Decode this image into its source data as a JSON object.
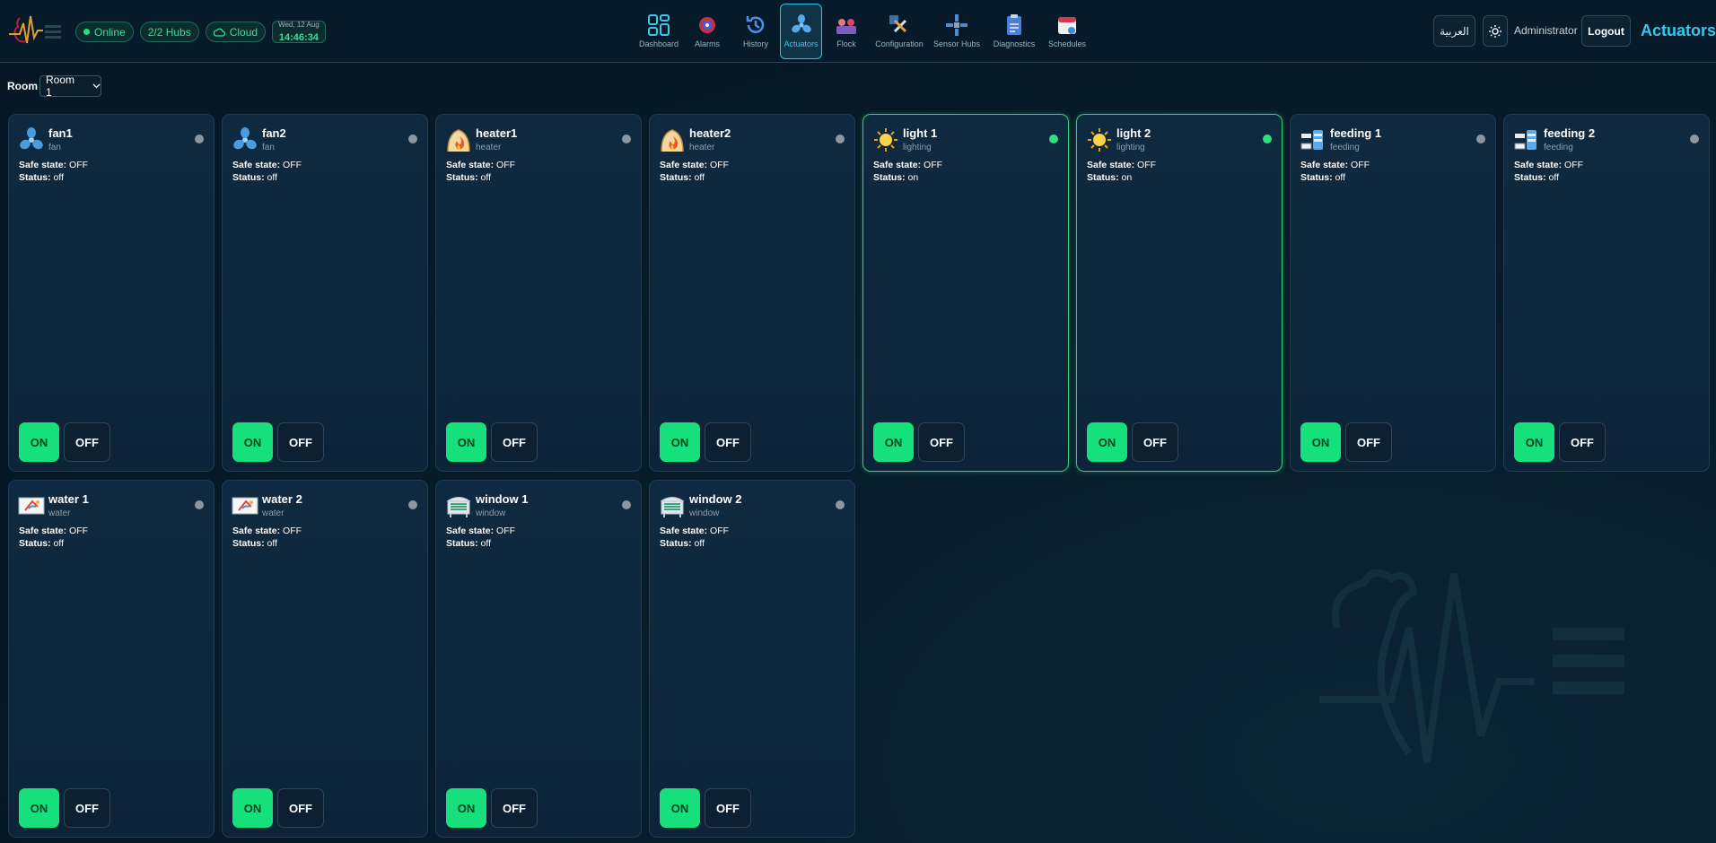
{
  "status": {
    "online_label": "Online",
    "hubs_label": "2/2 Hubs",
    "cloud_label": "Cloud",
    "date": "Wed, 12 Aug",
    "time": "14:46:34"
  },
  "nav": [
    {
      "label": "Dashboard",
      "icon": "dashboard-icon",
      "active": false
    },
    {
      "label": "Alarms",
      "icon": "alarm-icon",
      "active": false
    },
    {
      "label": "History",
      "icon": "history-icon",
      "active": false
    },
    {
      "label": "Actuators",
      "icon": "fan-icon",
      "active": true
    },
    {
      "label": "Flock",
      "icon": "flock-icon",
      "active": false
    },
    {
      "label": "Configuration",
      "icon": "tools-icon",
      "active": false
    },
    {
      "label": "Sensor Hubs",
      "icon": "satellite-icon",
      "active": false
    },
    {
      "label": "Diagnostics",
      "icon": "clipboard-icon",
      "active": false
    },
    {
      "label": "Schedules",
      "icon": "calendar-icon",
      "active": false
    }
  ],
  "header": {
    "language_button": "العربية",
    "theme_icon": "sun-icon",
    "user": "Administrator",
    "logout": "Logout",
    "page_title": "Actuators"
  },
  "room": {
    "label": "Room",
    "selected": "Room 1"
  },
  "labels": {
    "safe_state": "Safe state:",
    "status": "Status:",
    "on": "ON",
    "off": "OFF"
  },
  "actuators": [
    {
      "name": "fan1",
      "type": "fan",
      "safe_state": "OFF",
      "status": "off",
      "icon": "fan-icon"
    },
    {
      "name": "fan2",
      "type": "fan",
      "safe_state": "OFF",
      "status": "off",
      "icon": "fan-icon"
    },
    {
      "name": "heater1",
      "type": "heater",
      "safe_state": "OFF",
      "status": "off",
      "icon": "heater-icon"
    },
    {
      "name": "heater2",
      "type": "heater",
      "safe_state": "OFF",
      "status": "off",
      "icon": "heater-icon"
    },
    {
      "name": "light 1",
      "type": "lighting",
      "safe_state": "OFF",
      "status": "on",
      "icon": "sun-icon"
    },
    {
      "name": "light 2",
      "type": "lighting",
      "safe_state": "OFF",
      "status": "on",
      "icon": "sun-icon"
    },
    {
      "name": "feeding 1",
      "type": "feeding",
      "safe_state": "OFF",
      "status": "off",
      "icon": "feeder-icon"
    },
    {
      "name": "feeding 2",
      "type": "feeding",
      "safe_state": "OFF",
      "status": "off",
      "icon": "feeder-icon"
    },
    {
      "name": "water 1",
      "type": "water",
      "safe_state": "OFF",
      "status": "off",
      "icon": "water-icon"
    },
    {
      "name": "water 2",
      "type": "water",
      "safe_state": "OFF",
      "status": "off",
      "icon": "water-icon"
    },
    {
      "name": "window 1",
      "type": "window",
      "safe_state": "OFF",
      "status": "off",
      "icon": "window-icon"
    },
    {
      "name": "window 2",
      "type": "window",
      "safe_state": "OFF",
      "status": "off",
      "icon": "window-icon"
    }
  ],
  "colors": {
    "accent": "#35c9ea",
    "on_green": "#16e07b",
    "background": "#071b29"
  }
}
